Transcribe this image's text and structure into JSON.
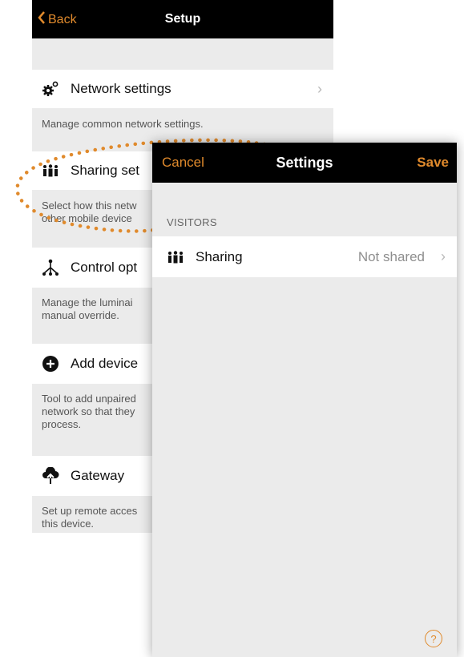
{
  "back_screen": {
    "nav": {
      "back_label": "Back",
      "title": "Setup"
    },
    "items": [
      {
        "label": "Network settings",
        "icon": "gear-icon",
        "description": "Manage common network settings."
      },
      {
        "label": "Sharing set",
        "icon": "people-icon",
        "description": "Select how this netw other mobile device"
      },
      {
        "label": "Control opt",
        "icon": "hierarchy-icon",
        "description": "Manage the luminai manual override."
      },
      {
        "label": "Add device",
        "icon": "add-circle-icon",
        "description": "Tool to add unpaired network so that they process."
      },
      {
        "label": "Gateway",
        "icon": "cloud-upload-icon",
        "description": "Set up remote acces this device."
      }
    ]
  },
  "front_screen": {
    "nav": {
      "cancel_label": "Cancel",
      "title": "Settings",
      "save_label": "Save"
    },
    "section_header": "VISITORS",
    "row": {
      "label": "Sharing",
      "value": "Not shared",
      "icon": "people-icon"
    },
    "help_symbol": "?"
  },
  "colors": {
    "accent": "#e08a2c",
    "navbar": "#000000",
    "background": "#ebebeb"
  }
}
